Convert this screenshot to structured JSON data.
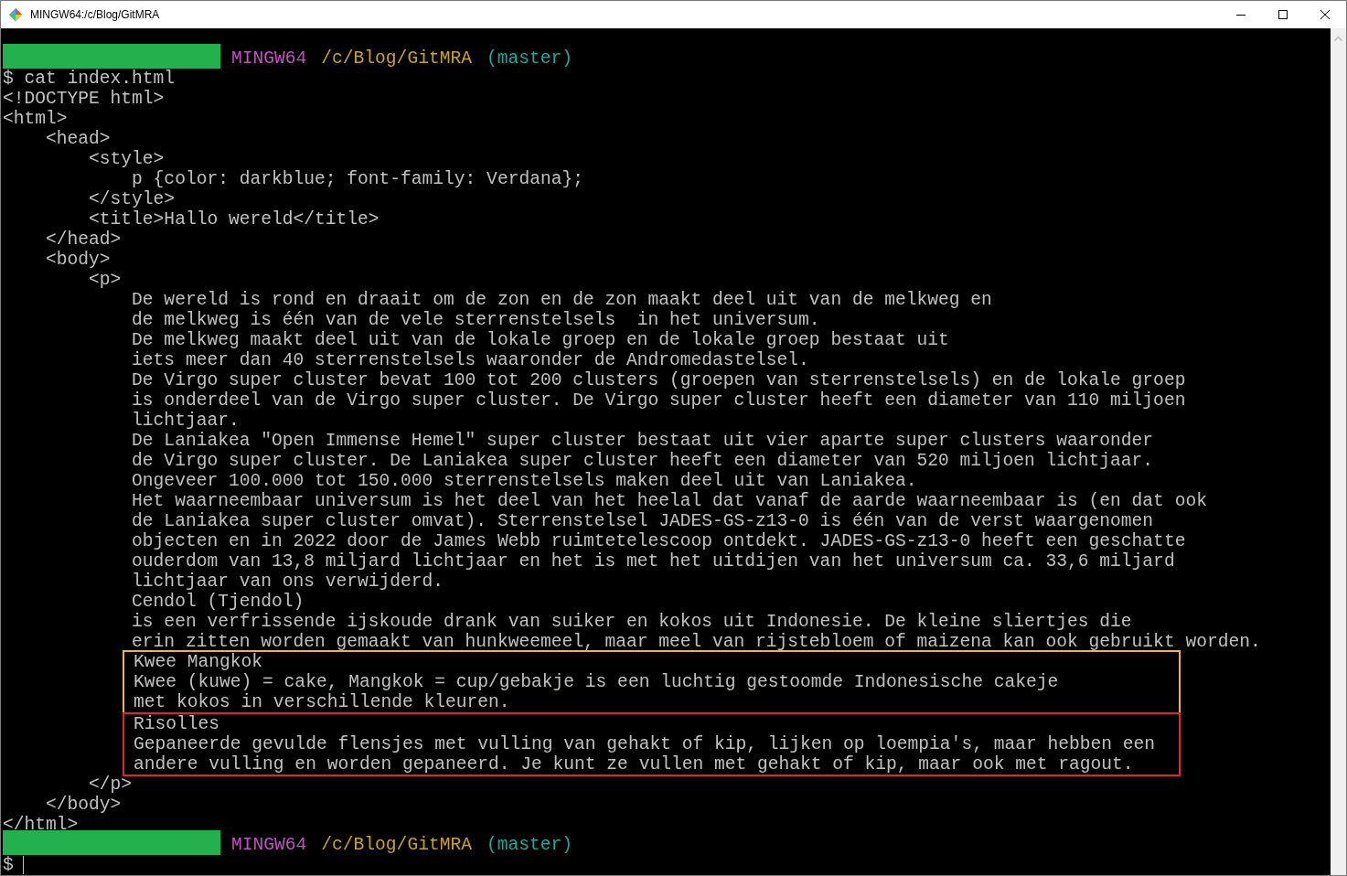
{
  "window": {
    "title": "MINGW64:/c/Blog/GitMRA"
  },
  "terminal": {
    "entries": [
      {
        "kind": "prompt",
        "system": "MINGW64",
        "path": "/c/Blog/GitMRA",
        "branch": "(master)"
      },
      {
        "kind": "output",
        "lines": [
          "$ cat index.html",
          "<!DOCTYPE html>",
          "<html>",
          "    <head>",
          "        <style>",
          "            p {color: darkblue; font-family: Verdana};",
          "        </style>",
          "        <title>Hallo wereld</title>",
          "    </head>",
          "    <body>",
          "        <p>",
          "            De wereld is rond en draait om de zon en de zon maakt deel uit van de melkweg en",
          "            de melkweg is één van de vele sterrenstelsels  in het universum.",
          "            De melkweg maakt deel uit van de lokale groep en de lokale groep bestaat uit",
          "            iets meer dan 40 sterrenstelsels waaronder de Andromedastelsel.",
          "            De Virgo super cluster bevat 100 tot 200 clusters (groepen van sterrenstelsels) en de lokale groep",
          "            is onderdeel van de Virgo super cluster. De Virgo super cluster heeft een diameter van 110 miljoen",
          "            lichtjaar.",
          "            De Laniakea \"Open Immense Hemel\" super cluster bestaat uit vier aparte super clusters waaronder",
          "            de Virgo super cluster. De Laniakea super cluster heeft een diameter van 520 miljoen lichtjaar.",
          "            Ongeveer 100.000 tot 150.000 sterrenstelsels maken deel uit van Laniakea.",
          "            Het waarneembaar universum is het deel van het heelal dat vanaf de aarde waarneembaar is (en dat ook",
          "            de Laniakea super cluster omvat). Sterrenstelsel JADES-GS-z13-0 is één van de verst waargenomen",
          "            objecten en in 2022 door de James Webb ruimtetelescoop ontdekt. JADES-GS-z13-0 heeft een geschatte",
          "            ouderdom van 13,8 miljard lichtjaar en het is met het uitdijen van het universum ca. 33,6 miljard",
          "            lichtjaar van ons verwijderd.",
          "            Cendol (Tjendol)",
          "            is een verfrissende ijskoude drank van suiker en kokos uit Indonesie. De kleine sliertjes die",
          "            erin zitten worden gemaakt van hunkweemeel, maar meel van rijstebloem of maizena kan ook gebruikt worden."
        ]
      },
      {
        "kind": "framed",
        "color": "#f4b42c",
        "lines": [
          "Kwee Mangkok",
          "Kwee (kuwe) = cake, Mangkok = cup/gebakje is een luchtig gestoomde Indonesische cakeje",
          "met kokos in verschillende kleuren."
        ]
      },
      {
        "kind": "framed",
        "color": "#e0262b",
        "lines": [
          "Risolles",
          "Gepaneerde gevulde flensjes met vulling van gehakt of kip, lijken op loempia's, maar hebben een",
          "andere vulling en worden gepaneerd. Je kunt ze vullen met gehakt of kip, maar ook met ragout."
        ]
      },
      {
        "kind": "output",
        "lines": [
          "        </p>",
          "    </body>",
          "</html>"
        ]
      },
      {
        "kind": "prompt",
        "system": "MINGW64",
        "path": "/c/Blog/GitMRA",
        "branch": "(master)"
      },
      {
        "kind": "input",
        "sign": "$"
      }
    ]
  }
}
